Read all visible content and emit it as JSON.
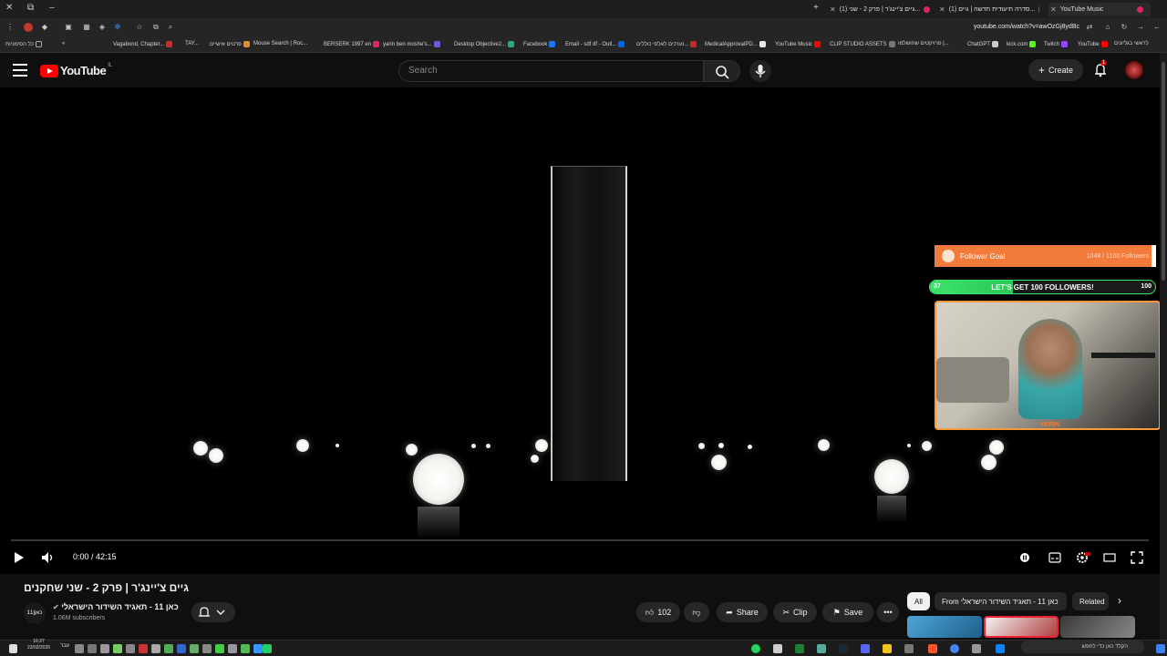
{
  "browser": {
    "tabs": [
      {
        "label": "YouTube Music"
      },
      {
        "label": "(1) סדרה תיעודית חדשה | גיים..."
      },
      {
        "label": "(1) גיים צ'יינג'ר | פרק 2 - שני..."
      }
    ],
    "url": "youtube.com/watch?v=awOzGj8ydBc",
    "bookmarks": [
      "כל הסימניות",
      "Vagabond, Chapter...",
      "TAY...",
      "פרטים אישיים",
      "Mouse Search | Roc...",
      "BERSERK 1997 en",
      "yarin ben moshe's...",
      "Desktop Objective2...",
      "Facebook",
      "Email - sdf df - Outl...",
      "נערכים לאלפי כוללים...",
      "MedicalApprovalPD...",
      "YouTube Music",
      "CLIP STUDIO ASSETS",
      "פרויקטים שהושלמו |...",
      "ChatGPT",
      "kick.com",
      "Twitch",
      "YouTube",
      "לראשי בגליונים"
    ]
  },
  "masthead": {
    "logo_text": "YouTube",
    "country_code": "IL",
    "search_placeholder": "Search",
    "create_label": "Create",
    "notification_count": "1"
  },
  "player": {
    "time": "0:00 / 42:15",
    "progress": 0
  },
  "overlay": {
    "follower_goal_label": "Follower Goal",
    "follower_goal_count": "1048 / 1100 Followers",
    "goal_bar_text": "LET'S GET 100 FOLLOWERS!",
    "goal_bar_left": "37",
    "goal_bar_right": "100",
    "goal_fraction": 0.37,
    "webcam_tag": "YARIN"
  },
  "video": {
    "title": "גיים צ'יינג'ר | פרק 2 - שני שחקנים",
    "channel_name": "כאן 11 - תאגיד השידור הישראלי",
    "channel_avatar_text": "כאן|11",
    "subscribers": "1.06M subscribers",
    "likes": "102",
    "share_label": "Share",
    "clip_label": "Clip",
    "save_label": "Save"
  },
  "chips": {
    "all": "All",
    "from": "From כאן 11 - תאגיד השידור הישראלי",
    "related": "Related"
  },
  "taskbar": {
    "time": "16:27",
    "date": "23/02/2026",
    "lang": "עבר",
    "search_placeholder": "הקלד כאן כדי לחפש"
  },
  "colors": {
    "yt_red": "#ff0000",
    "goal_orange": "#f27a3a",
    "goal_green": "#3be36a",
    "bg": "#0f0f0f"
  }
}
